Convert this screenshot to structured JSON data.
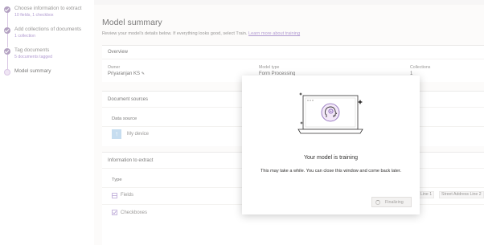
{
  "steps": [
    {
      "title": "Choose information to extract",
      "sub": "10 fields, 1 checkbox"
    },
    {
      "title": "Add collections of documents",
      "sub": "1 collection"
    },
    {
      "title": "Tag documents",
      "sub": "5 documents tagged"
    },
    {
      "title": "Model summary",
      "sub": ""
    }
  ],
  "page": {
    "title": "Model summary",
    "desc": "Review your model's details below. If everything looks good, select Train.",
    "learn_link": "Learn more about training"
  },
  "overview": {
    "heading": "Overview",
    "owner_label": "Owner",
    "owner_value": "Priyaranjan KS",
    "model_type_label": "Model type",
    "model_type_value": "Form Processing",
    "collections_label": "Collections",
    "collections_value": "1"
  },
  "doc_sources": {
    "heading": "Document sources",
    "column": "Data source",
    "source": "My device"
  },
  "info_extract": {
    "heading": "Information to extract",
    "column": "Type",
    "rows": [
      {
        "label": "Fields"
      },
      {
        "label": "Checkboxes"
      }
    ],
    "tags": [
      "Line 1",
      "Street Address Line 2"
    ]
  },
  "dialog": {
    "title": "Your model is training",
    "message": "This may take a while. You can close this window and come back later.",
    "button": "Finalizing"
  },
  "colors": {
    "accent": "#8764b8",
    "step_done": "#8a6fa0"
  }
}
